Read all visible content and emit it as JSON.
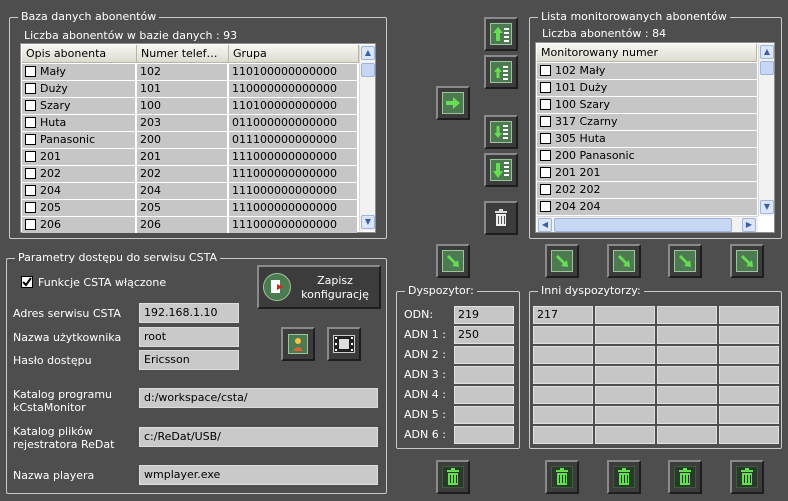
{
  "db": {
    "title": "Baza danych abonentów",
    "count": "Liczba abonentów w bazie danych : 93",
    "columns": [
      "Opis abonenta",
      "Numer telef…",
      "Grupa"
    ],
    "rows": [
      {
        "name": "Mały",
        "number": "102",
        "group": "110100000000000"
      },
      {
        "name": "Duży",
        "number": "101",
        "group": "110000000000000"
      },
      {
        "name": "Szary",
        "number": "100",
        "group": "110100000000000"
      },
      {
        "name": "Huta",
        "number": "203",
        "group": "011000000000000"
      },
      {
        "name": "Panasonic",
        "number": "200",
        "group": "011100000000000"
      },
      {
        "name": "201",
        "number": "201",
        "group": "111000000000000"
      },
      {
        "name": "202",
        "number": "202",
        "group": "111000000000000"
      },
      {
        "name": "204",
        "number": "204",
        "group": "111000000000000"
      },
      {
        "name": "205",
        "number": "205",
        "group": "111000000000000"
      },
      {
        "name": "206",
        "number": "206",
        "group": "111000000000000"
      }
    ]
  },
  "monitored": {
    "title": "Lista monitorowanych abonentów",
    "count": "Liczba abonentów : 84",
    "column": "Monitorowany numer",
    "rows": [
      "102 Mały",
      "101 Duży",
      "100 Szary",
      "317 Czarny",
      "305 Huta",
      "200 Panasonic",
      "201 201",
      "202 202",
      "204 204"
    ]
  },
  "csta": {
    "title": "Parametry dostępu do serwisu CSTA",
    "checkbox_label": "Funkcje CSTA włączone",
    "save_label": "Zapisz konfigurację",
    "address_label": "Adres serwisu CSTA",
    "address_value": "192.168.1.10",
    "user_label": "Nazwa użytkownika",
    "user_value": "root",
    "password_label": "Hasło dostępu",
    "password_value": "Ericsson",
    "catalog_label_1": "Katalog programu",
    "catalog_label_2": "kCstaMonitor",
    "catalog_value": "d:/workspace/csta/",
    "recorder_label_1": "Katalog plików",
    "recorder_label_2": "rejestratora ReDat",
    "recorder_value": "c:/ReDat/USB/",
    "player_label": "Nazwa playera",
    "player_value": "wmplayer.exe"
  },
  "dispatcher": {
    "title": "Dyspozytor:",
    "labels": [
      "ODN:",
      "ADN 1 :",
      "ADN 2 :",
      "ADN 3 :",
      "ADN 4 :",
      "ADN 5 :",
      "ADN 6 :"
    ],
    "values": [
      "219",
      "250",
      "",
      "",
      "",
      "",
      ""
    ]
  },
  "others": {
    "title": "Inni dyspozytorzy:",
    "first_value": "217"
  },
  "colors": {
    "background": "#4e4e4e",
    "icon_green": "#4d7a50",
    "arrow_green": "#66dd55"
  }
}
